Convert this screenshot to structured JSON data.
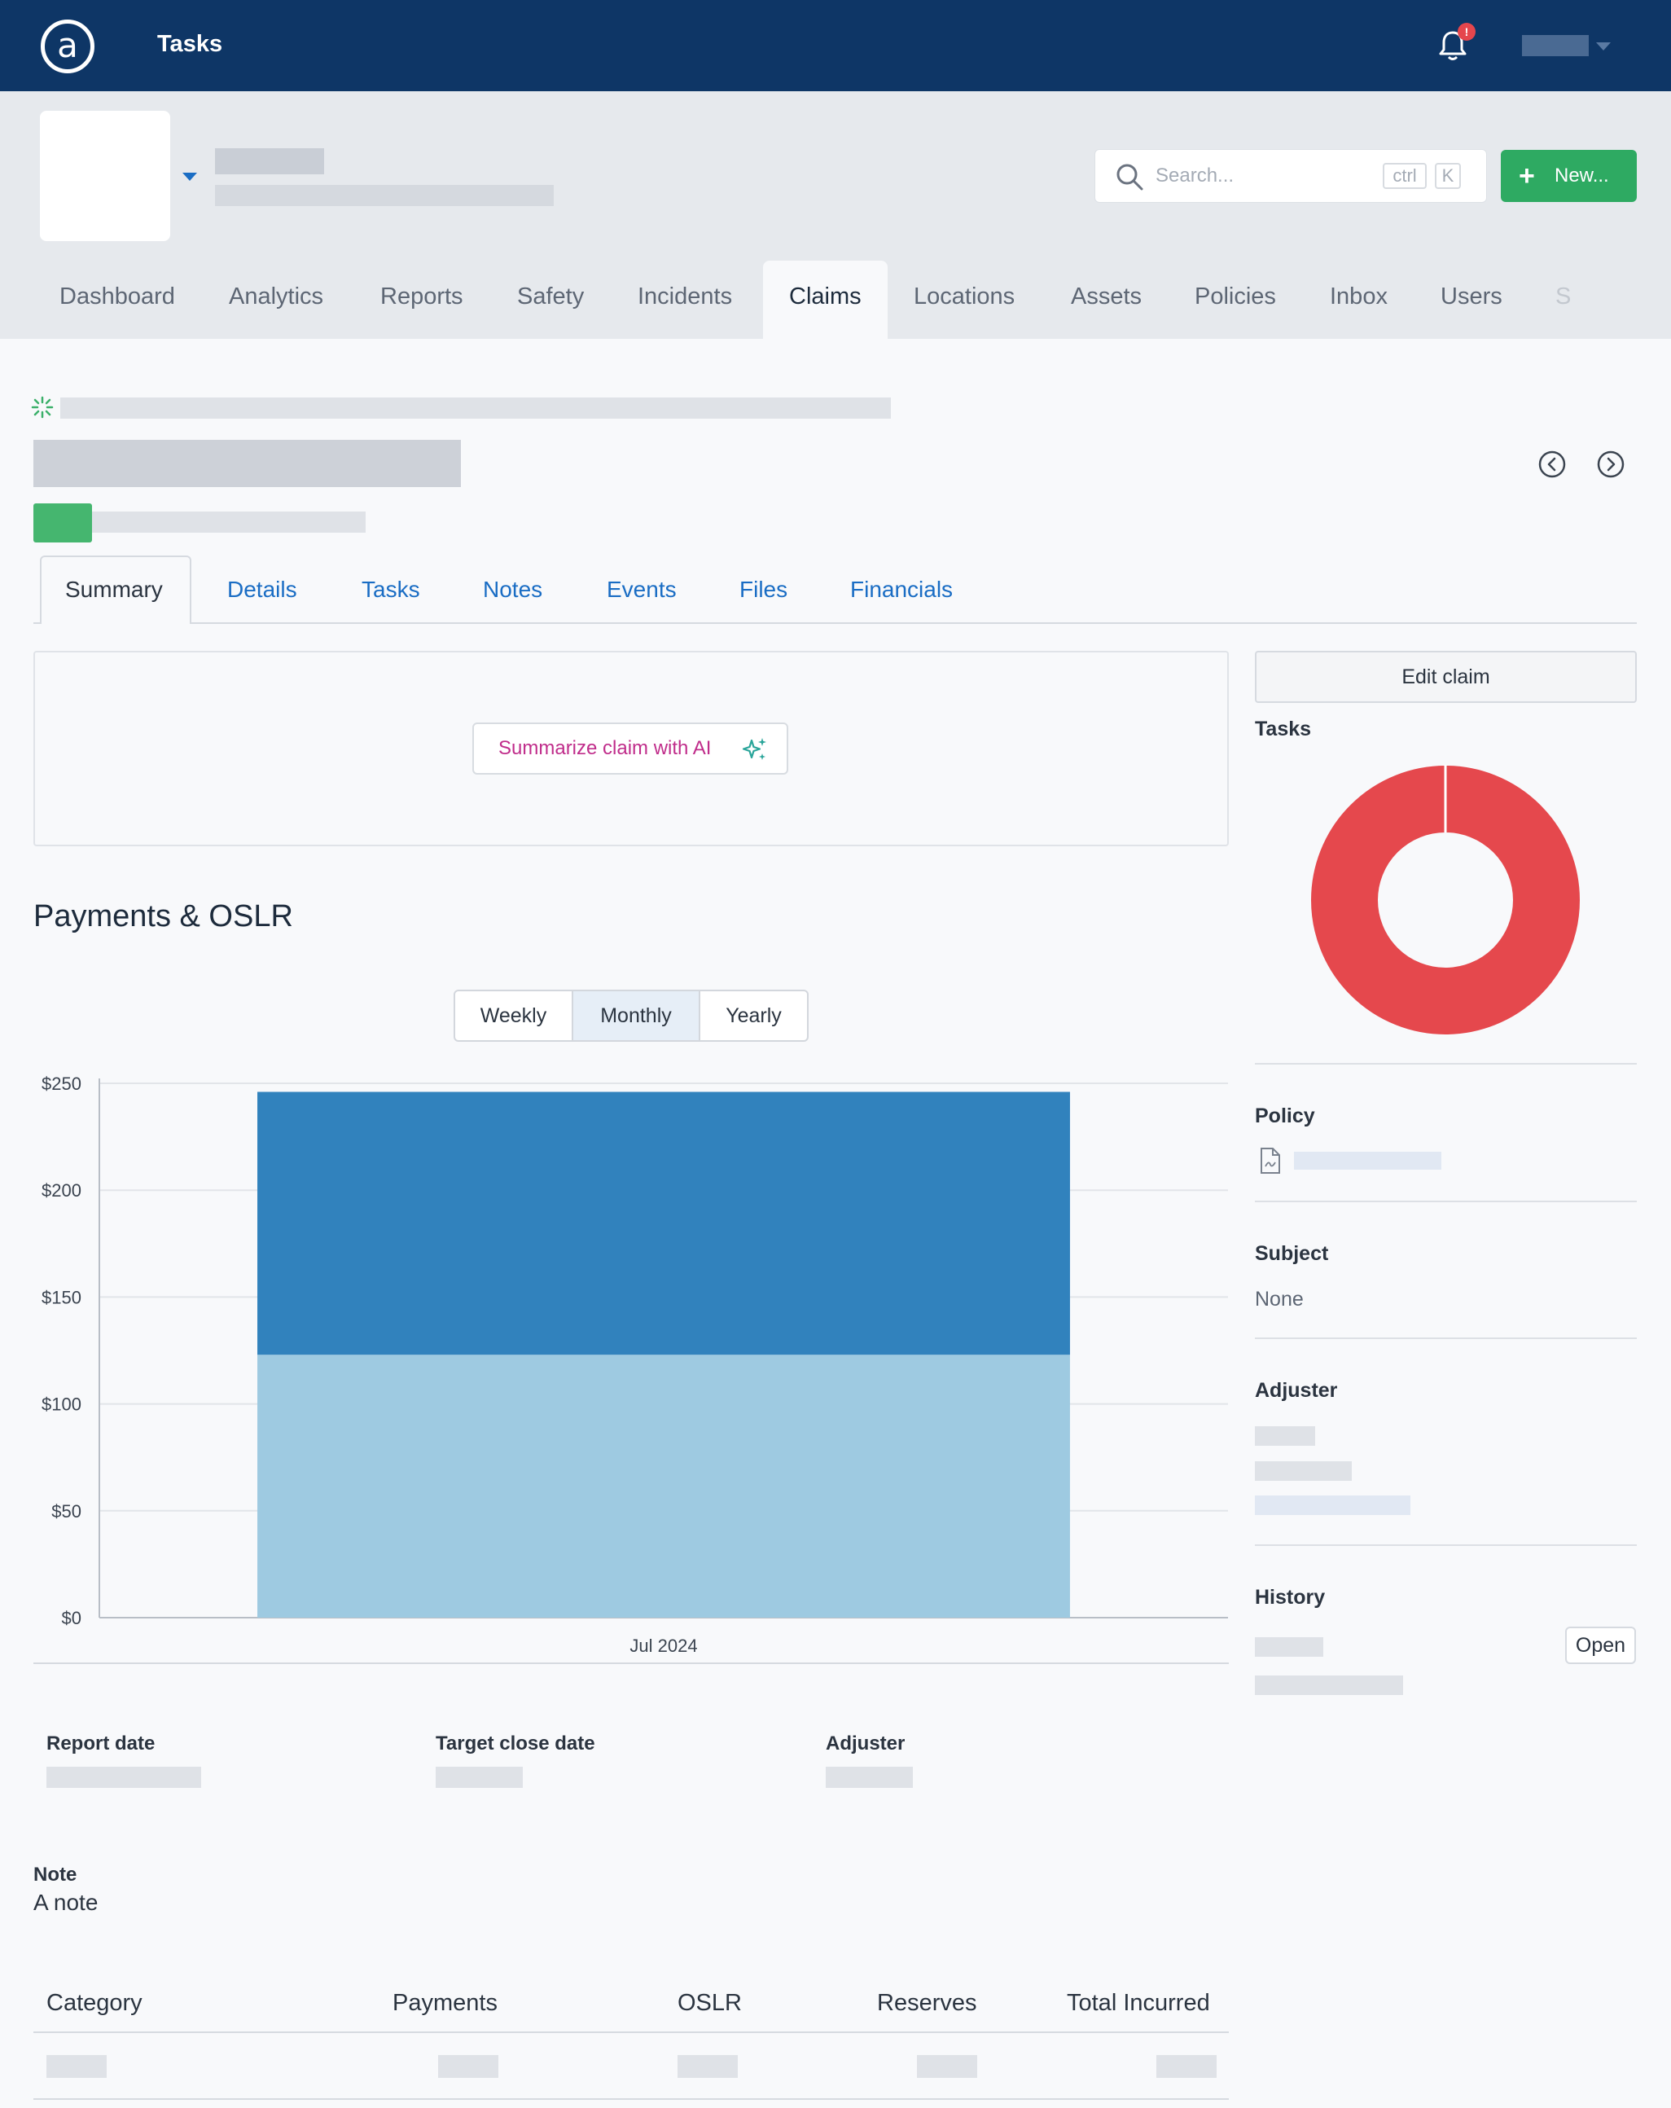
{
  "app": {
    "title": "Tasks",
    "logo": "a",
    "notification_badge": "!"
  },
  "search": {
    "placeholder": "Search...",
    "shortcut_mod": "ctrl",
    "shortcut_key": "K"
  },
  "new_button": {
    "label": "New..."
  },
  "nav": {
    "tabs": [
      "Dashboard",
      "Analytics",
      "Reports",
      "Safety",
      "Incidents",
      "Claims",
      "Locations",
      "Assets",
      "Policies",
      "Inbox",
      "Users",
      "S"
    ],
    "active": "Claims"
  },
  "claim_tabs": {
    "tabs": [
      "Summary",
      "Details",
      "Tasks",
      "Notes",
      "Events",
      "Files",
      "Financials"
    ],
    "active": "Summary"
  },
  "ai": {
    "summarize_label": "Summarize claim with AI"
  },
  "payments": {
    "title": "Payments & OSLR",
    "periods": [
      "Weekly",
      "Monthly",
      "Yearly"
    ],
    "active_period": "Monthly"
  },
  "chart_data": {
    "type": "bar",
    "stacked": true,
    "categories": [
      "Jul 2024"
    ],
    "series": [
      {
        "color": "#9ecae1",
        "values": [
          123
        ]
      },
      {
        "color": "#3182bd",
        "values": [
          123
        ]
      }
    ],
    "ylim": [
      0,
      250
    ],
    "yticks": [
      "$0",
      "$50",
      "$100",
      "$150",
      "$200",
      "$250"
    ],
    "grid": true
  },
  "fields": {
    "report_date_label": "Report date",
    "target_close_label": "Target close date",
    "adjuster_label": "Adjuster",
    "note_label": "Note",
    "note_value": "A note"
  },
  "table": {
    "headers": [
      "Category",
      "Payments",
      "OSLR",
      "Reserves",
      "Total Incurred"
    ]
  },
  "sidebar": {
    "edit_claim": "Edit claim",
    "tasks_label": "Tasks",
    "tasks_chart": {
      "type": "pie",
      "donut": true,
      "values": [
        100
      ],
      "color": "#e5484d"
    },
    "policy_label": "Policy",
    "subject_label": "Subject",
    "subject_value": "None",
    "adjuster_label": "Adjuster",
    "history_label": "History",
    "open_label": "Open"
  }
}
